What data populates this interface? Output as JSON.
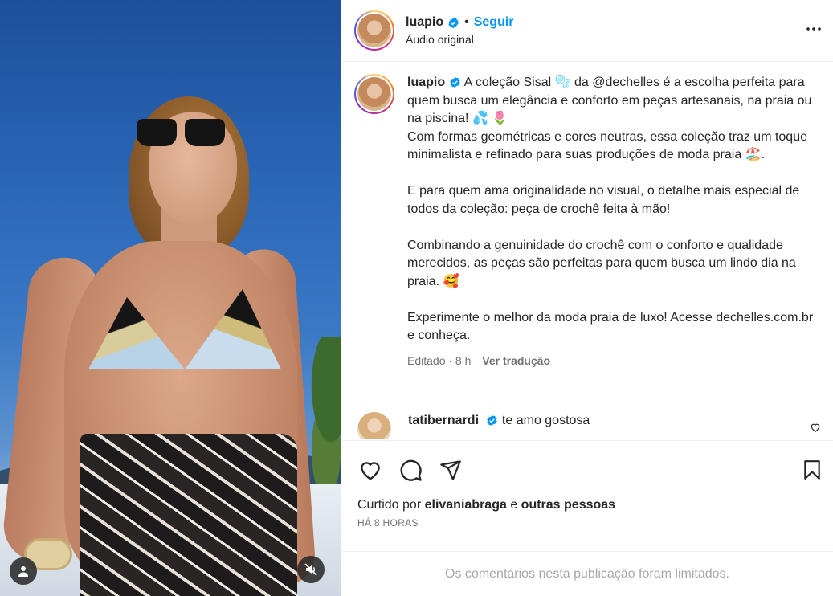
{
  "post": {
    "username": "luapio",
    "separator": "•",
    "follow_label": "Seguir",
    "audio_label": "Áudio original"
  },
  "caption": {
    "username": "luapio",
    "text": "A coleção Sisal 🫧 da @dechelles é a escolha perfeita para quem busca um elegância e conforto em peças artesanais, na praia ou na piscina! 💦 🌷\nCom formas geométricas e cores neutras, essa coleção traz um toque minimalista e refinado para suas produções de moda praia 🏖️.\n\nE para quem ama originalidade no visual, o detalhe mais especial de todos da coleção: peça de crochê feita à mão!\n\nCombinando a genuinidade do crochê com o conforto e qualidade merecidos, as peças são perfeitas para quem busca um lindo dia na praia. 🥰\n\nExperimente o melhor da moda praia de luxo! Acesse dechelles.com.br e conheça.",
    "edited": "Editado · 8 h",
    "translate_label": "Ver tradução"
  },
  "comment": {
    "username": "tatibernardi",
    "text": "te amo gostosa"
  },
  "likes": {
    "prefix": "Curtido por ",
    "user": "elivaniabraga",
    "conj": " e ",
    "others": "outras pessoas"
  },
  "time_ago": "HÁ 8 HORAS",
  "comments_limited": "Os comentários nesta publicação foram limitados.",
  "icons": {
    "verified": "verified-badge-icon",
    "more": "more-options-icon",
    "like": "heart-icon",
    "comment": "comment-icon",
    "share": "share-icon",
    "save": "bookmark-icon",
    "user_tag": "user-tag-icon",
    "mute": "mute-icon"
  },
  "colors": {
    "accent": "#0095f6",
    "verified": "#0095f6",
    "muted": "#737373"
  }
}
